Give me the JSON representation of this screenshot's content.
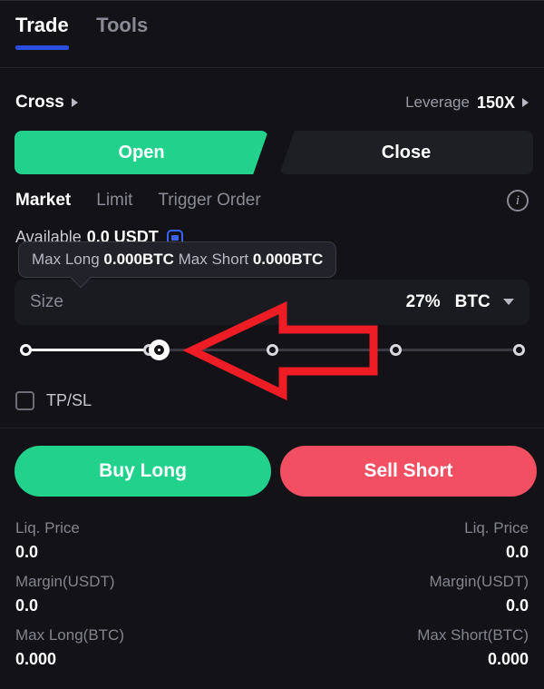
{
  "tabs": [
    {
      "label": "Trade",
      "active": true
    },
    {
      "label": "Tools",
      "active": false
    }
  ],
  "margin": {
    "mode_label": "Cross",
    "leverage_label": "Leverage",
    "leverage_value": "150X"
  },
  "position_actions": {
    "open_label": "Open",
    "close_label": "Close"
  },
  "order_types": [
    {
      "label": "Market",
      "active": true
    },
    {
      "label": "Limit",
      "active": false
    },
    {
      "label": "Trigger Order",
      "active": false
    }
  ],
  "info_glyph": "i",
  "available": {
    "label": "Available",
    "value": "0.0 USDT"
  },
  "tooltip": {
    "max_long_label": "Max Long",
    "max_long_value": "0.000BTC",
    "max_short_label": "Max Short",
    "max_short_value": "0.000BTC"
  },
  "size": {
    "placeholder": "Size",
    "percent": "27%",
    "unit": "BTC"
  },
  "slider": {
    "value_percent": 27,
    "ticks": [
      0,
      25,
      50,
      75,
      100
    ]
  },
  "tpsl": {
    "label": "TP/SL",
    "checked": false
  },
  "trade_actions": {
    "buy_label": "Buy Long",
    "sell_label": "Sell Short"
  },
  "stats": {
    "rows": [
      {
        "left_key": "Liq. Price",
        "left_value": "0.0",
        "right_key": "Liq. Price",
        "right_value": "0.0"
      },
      {
        "left_key": "Margin(USDT)",
        "left_value": "0.0",
        "right_key": "Margin(USDT)",
        "right_value": "0.0"
      },
      {
        "left_key": "Max Long(BTC)",
        "left_value": "0.000",
        "right_key": "Max Short(BTC)",
        "right_value": "0.000"
      }
    ]
  },
  "colors": {
    "accent_blue": "#2a4fe0",
    "long_green": "#22d18c",
    "short_red": "#f24f63",
    "annotation_red": "#ee1c25",
    "background": "#121217",
    "panel": "#1a1a21"
  },
  "annotation": {
    "shape": "left-pointing-arrow-outline",
    "color": "#ee1c25"
  }
}
